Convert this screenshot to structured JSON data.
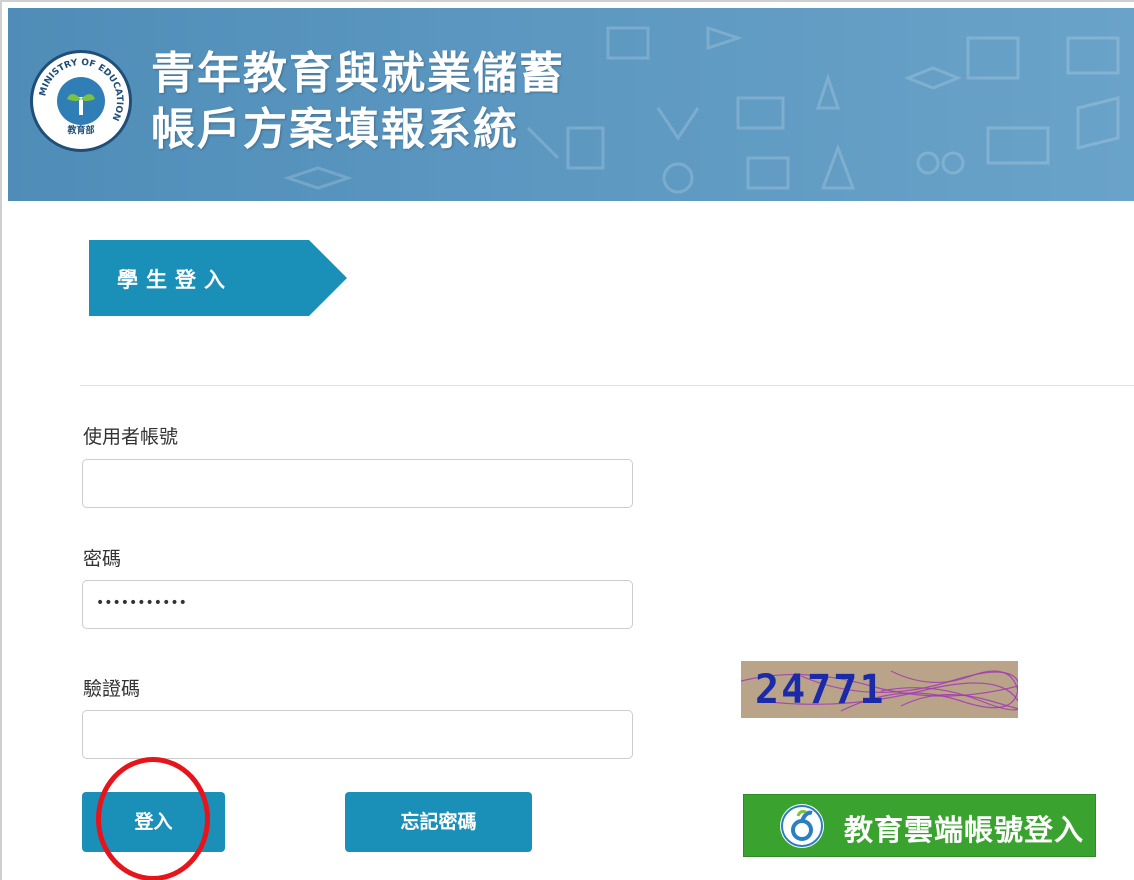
{
  "header": {
    "title_line1": "青年教育與就業儲蓄",
    "title_line2": "帳戶方案填報系統",
    "logo_ring_text": "MINISTRY OF EDUCATION",
    "logo_center_text": "教育部"
  },
  "section": {
    "tag_label": "學生登入"
  },
  "form": {
    "username_label": "使用者帳號",
    "username_value": "",
    "password_label": "密碼",
    "password_value": "•••••••••••",
    "captcha_label": "驗證碼",
    "captcha_value": "",
    "captcha_image_text": "24771"
  },
  "buttons": {
    "login": "登入",
    "forgot_password": "忘記密碼",
    "cloud_login": "教育雲端帳號登入"
  },
  "colors": {
    "header_blue": "#5a96bf",
    "button_blue": "#1a8fb8",
    "cloud_green": "#3aa32f",
    "highlight_red": "#e8141b"
  }
}
